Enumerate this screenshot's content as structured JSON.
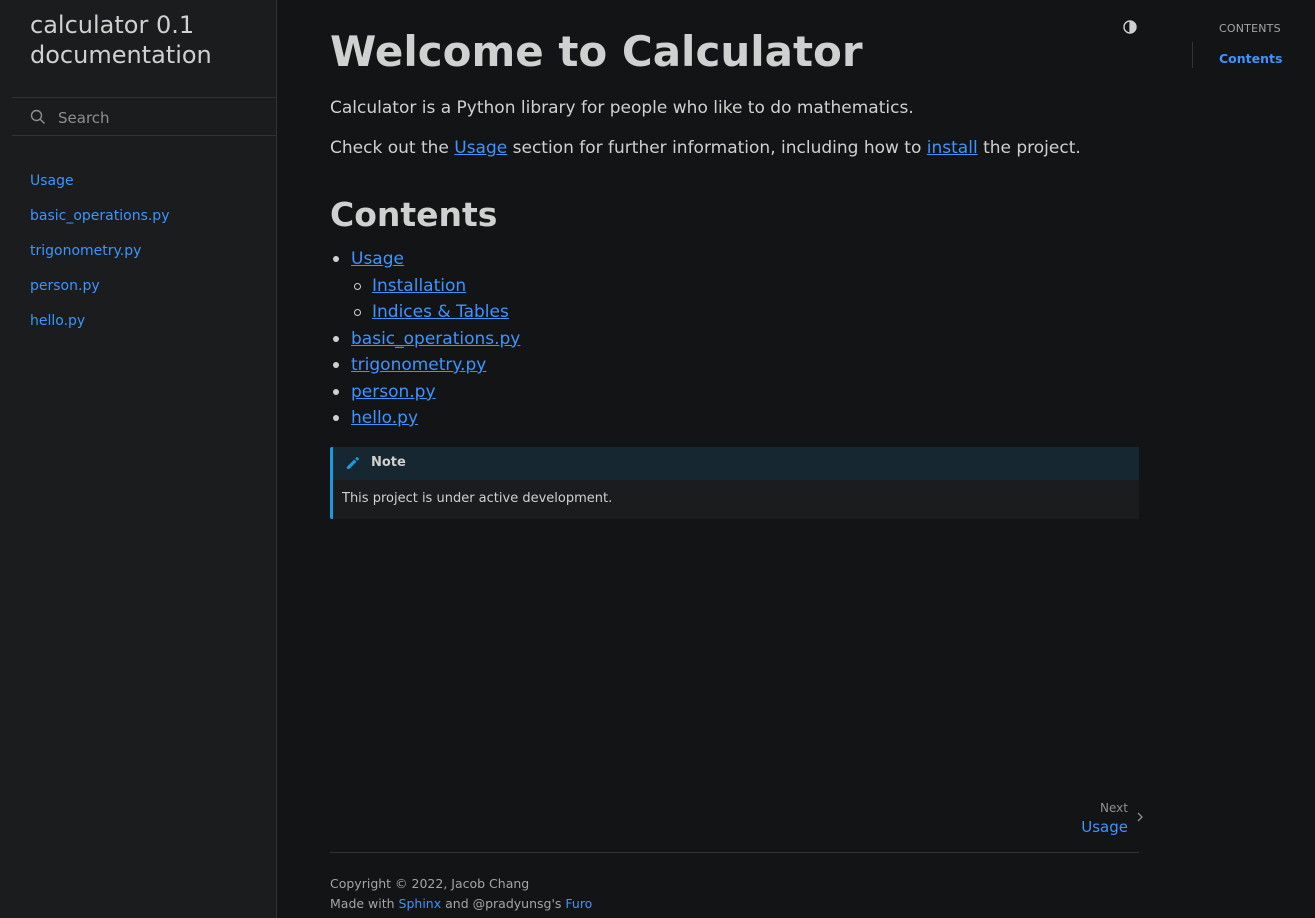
{
  "sidebar": {
    "brand": "calculator 0.1 documentation",
    "search_placeholder": "Search",
    "items": [
      {
        "label": "Usage"
      },
      {
        "label": "basic_operations.py"
      },
      {
        "label": "trigonometry.py"
      },
      {
        "label": "person.py"
      },
      {
        "label": "hello.py"
      }
    ]
  },
  "main": {
    "title": "Welcome to Calculator",
    "intro": "Calculator is a Python library for people who like to do mathematics.",
    "check_prefix": "Check out the ",
    "check_link_usage": "Usage",
    "check_middle": " section for further information, including how to ",
    "check_link_install": "install",
    "check_suffix": " the project.",
    "contents_heading": "Contents",
    "toc": [
      {
        "label": "Usage",
        "level": 1
      },
      {
        "label": "Installation",
        "level": 2
      },
      {
        "label": "Indices & Tables",
        "level": 2
      },
      {
        "label": "basic_operations.py",
        "level": 1
      },
      {
        "label": "trigonometry.py",
        "level": 1
      },
      {
        "label": "person.py",
        "level": 1
      },
      {
        "label": "hello.py",
        "level": 1
      }
    ],
    "note": {
      "title": "Note",
      "body": "This project is under active development."
    }
  },
  "pagination": {
    "next_label": "Next",
    "next_title": "Usage"
  },
  "footer": {
    "copyright": "Copyright © 2022, Jacob Chang",
    "made_with": "Made with ",
    "sphinx": "Sphinx",
    "and": " and @pradyunsg's ",
    "furo": "Furo"
  },
  "toc_drawer": {
    "title": "Contents",
    "item": "Contents"
  },
  "colors": {
    "background": "#131416",
    "sidebar_background": "#1a1c1e",
    "link": "#3d94ff",
    "note_accent": "#1a9bde"
  }
}
